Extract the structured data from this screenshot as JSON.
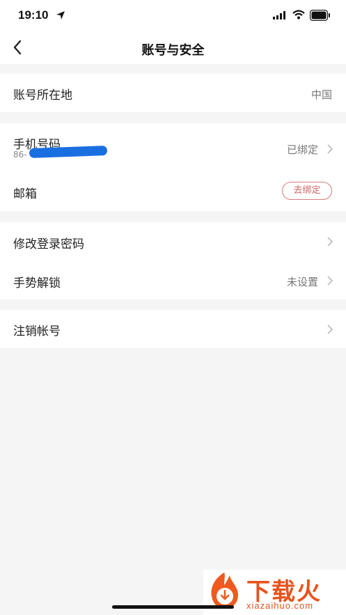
{
  "status_bar": {
    "time": "19:10"
  },
  "nav": {
    "title": "账号与安全"
  },
  "sections": {
    "region": {
      "label": "账号所在地",
      "value": "中国"
    },
    "phone": {
      "label": "手机号码",
      "number_prefix": "86-",
      "value": "已绑定"
    },
    "email": {
      "label": "邮箱",
      "action": "去绑定"
    },
    "password": {
      "label": "修改登录密码"
    },
    "gesture": {
      "label": "手势解锁",
      "value": "未设置"
    },
    "cancel_account": {
      "label": "注销帐号"
    }
  },
  "watermark": {
    "brand": "下载火",
    "url": "xiazaihuo.com"
  },
  "colors": {
    "background": "#f5f5f5",
    "accent_red": "#d06464",
    "watermark_orange": "#e8531d"
  }
}
